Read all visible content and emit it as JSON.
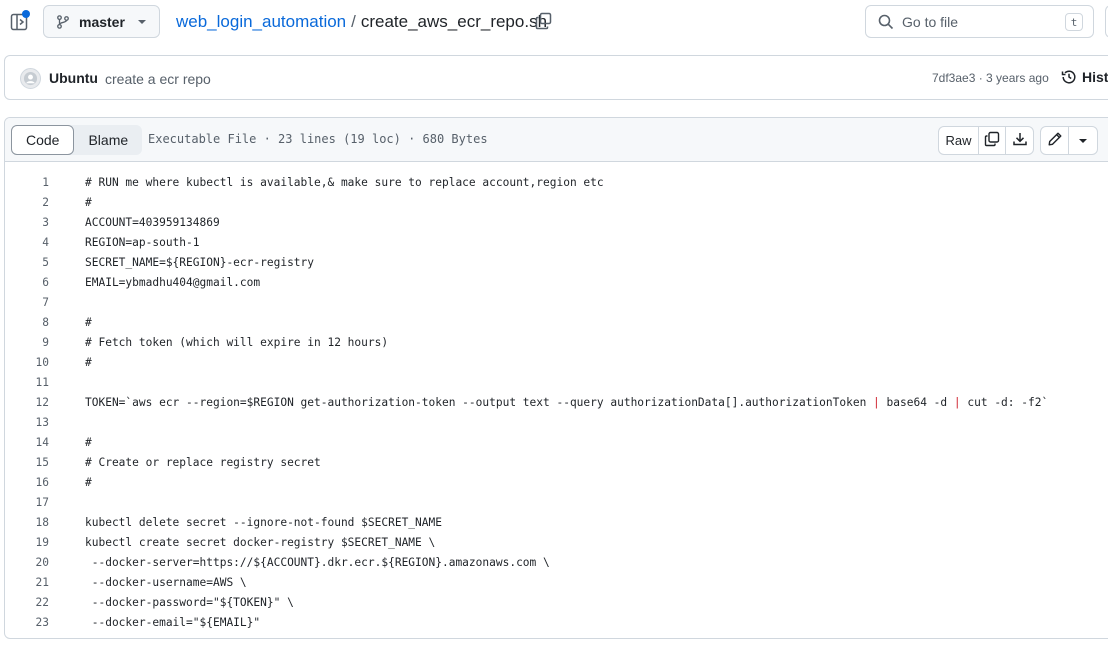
{
  "header": {
    "branch": "master",
    "repo": "web_login_automation",
    "separator": "/",
    "file": "create_aws_ecr_repo.sh",
    "search_placeholder": "Go to file",
    "search_shortcut": "t"
  },
  "commit": {
    "author": "Ubuntu",
    "message": "create a ecr repo",
    "meta": "7df3ae3 · 3 years ago",
    "history_label": "Histo"
  },
  "file_toolbar": {
    "tabs": [
      {
        "label": "Code",
        "active": true
      },
      {
        "label": "Blame",
        "active": false
      }
    ],
    "info": "Executable File · 23 lines (19 loc) · 680 Bytes",
    "raw_label": "Raw"
  },
  "icons": {
    "sidebar_toggle": "sidebar-expand-icon",
    "branch": "git-branch-icon",
    "caret": "triangle-down-icon",
    "copy": "copy-icon",
    "search": "search-icon",
    "history": "history-icon",
    "download": "download-icon",
    "edit": "pencil-icon"
  },
  "colors": {
    "link": "#0969da",
    "notification_dot": "#0969da",
    "pipe_operator": "#cf222e",
    "border": "#d0d7de"
  },
  "code": {
    "lines": [
      {
        "n": "1",
        "t": "# RUN me where kubectl is available,& make sure to replace account,region etc"
      },
      {
        "n": "2",
        "t": "#"
      },
      {
        "n": "3",
        "t": "ACCOUNT=403959134869"
      },
      {
        "n": "4",
        "t": "REGION=ap-south-1"
      },
      {
        "n": "5",
        "t": "SECRET_NAME=${REGION}-ecr-registry"
      },
      {
        "n": "6",
        "t": "EMAIL=ybmadhu404@gmail.com"
      },
      {
        "n": "7",
        "t": ""
      },
      {
        "n": "8",
        "t": "#"
      },
      {
        "n": "9",
        "t": "# Fetch token (which will expire in 12 hours)"
      },
      {
        "n": "10",
        "t": "#"
      },
      {
        "n": "11",
        "t": ""
      },
      {
        "n": "12",
        "t_parts": [
          "TOKEN=`aws ecr --region=$REGION get-authorization-token --output text --query authorizationData[].authorizationToken ",
          "|",
          " base64 -d ",
          "|",
          " cut -d: -f2`"
        ]
      },
      {
        "n": "13",
        "t": ""
      },
      {
        "n": "14",
        "t": "#"
      },
      {
        "n": "15",
        "t": "# Create or replace registry secret"
      },
      {
        "n": "16",
        "t": "#"
      },
      {
        "n": "17",
        "t": ""
      },
      {
        "n": "18",
        "t": "kubectl delete secret --ignore-not-found $SECRET_NAME"
      },
      {
        "n": "19",
        "t": "kubectl create secret docker-registry $SECRET_NAME \\"
      },
      {
        "n": "20",
        "t": " --docker-server=https://${ACCOUNT}.dkr.ecr.${REGION}.amazonaws.com \\"
      },
      {
        "n": "21",
        "t": " --docker-username=AWS \\"
      },
      {
        "n": "22",
        "t": " --docker-password=\"${TOKEN}\" \\"
      },
      {
        "n": "23",
        "t": " --docker-email=\"${EMAIL}\""
      }
    ]
  }
}
